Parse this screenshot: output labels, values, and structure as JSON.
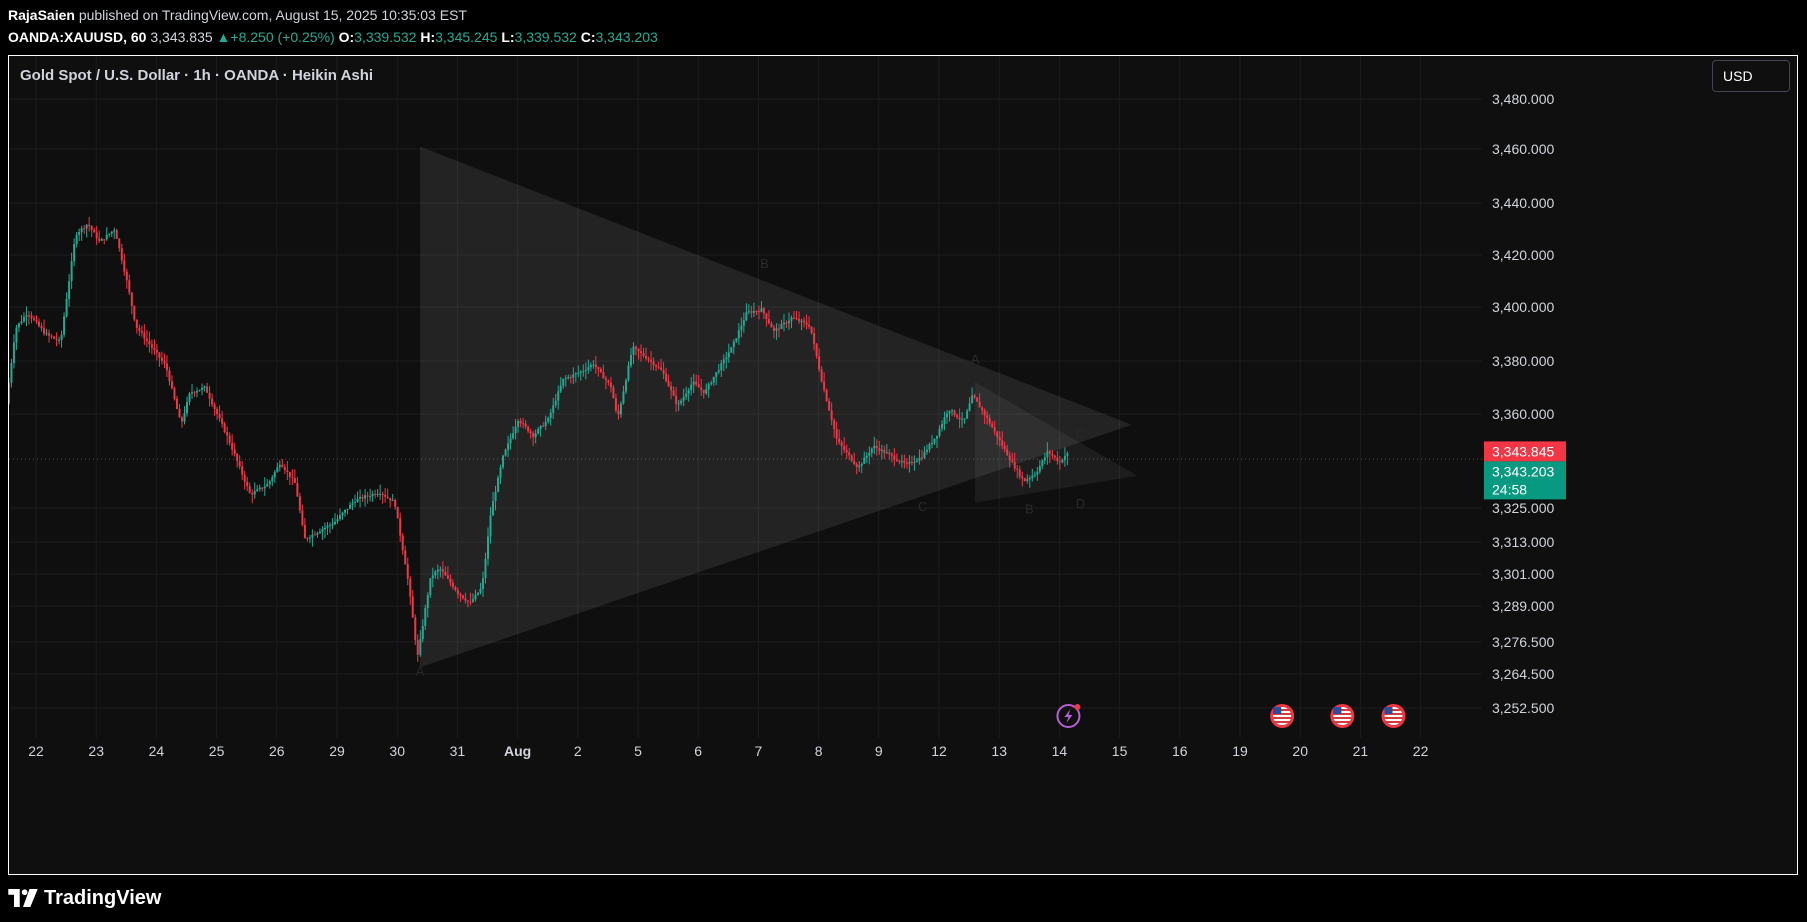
{
  "header": {
    "author": "RajaSaien",
    "published_text": "published on TradingView.com, August 15, 2025 10:35:03 EST",
    "symbol": "OANDA:XAUUSD, 60",
    "last": "3,343.835",
    "arrow": "▲",
    "change": "+8.250 (+0.25%)",
    "o_label": "O:",
    "o_value": "3,339.532",
    "h_label": "H:",
    "h_value": "3,345.245",
    "l_label": "L:",
    "l_value": "3,339.532",
    "c_label": "C:",
    "c_value": "3,343.203"
  },
  "chart": {
    "title": "Gold Spot / U.S. Dollar · 1h · OANDA · Heikin Ashi",
    "currency": "USD"
  },
  "footer": {
    "brand": "TradingView"
  },
  "chart_data": {
    "type": "candlestick",
    "title": "Gold Spot / U.S. Dollar · 1h · OANDA · Heikin Ashi",
    "grid": true,
    "y_axis_side": "right",
    "y_ticks": [
      {
        "v": 3480,
        "label": "3,480.000"
      },
      {
        "v": 3460,
        "label": "3,460.000"
      },
      {
        "v": 3440,
        "label": "3,440.000"
      },
      {
        "v": 3420,
        "label": "3,420.000"
      },
      {
        "v": 3400,
        "label": "3,400.000"
      },
      {
        "v": 3380,
        "label": "3,380.000"
      },
      {
        "v": 3360,
        "label": "3,360.000"
      },
      {
        "v": 3325,
        "label": "3,325.000"
      },
      {
        "v": 3313,
        "label": "3,313.000"
      },
      {
        "v": 3301,
        "label": "3,301.000"
      },
      {
        "v": 3289,
        "label": "3,289.000"
      },
      {
        "v": 3276.5,
        "label": "3,276.500"
      },
      {
        "v": 3264.5,
        "label": "3,264.500"
      },
      {
        "v": 3252.5,
        "label": "3,252.500"
      }
    ],
    "x_ticks": [
      {
        "i": 0,
        "label": "22"
      },
      {
        "i": 1,
        "label": "23"
      },
      {
        "i": 2,
        "label": "24"
      },
      {
        "i": 3,
        "label": "25"
      },
      {
        "i": 4,
        "label": "26"
      },
      {
        "i": 5,
        "label": "29"
      },
      {
        "i": 6,
        "label": "30"
      },
      {
        "i": 7,
        "label": "31"
      },
      {
        "i": 8,
        "label": "Aug",
        "bold": true
      },
      {
        "i": 9,
        "label": "2"
      },
      {
        "i": 10,
        "label": "5"
      },
      {
        "i": 11,
        "label": "6"
      },
      {
        "i": 12,
        "label": "7"
      },
      {
        "i": 13,
        "label": "8"
      },
      {
        "i": 14,
        "label": "9"
      },
      {
        "i": 15,
        "label": "12"
      },
      {
        "i": 16,
        "label": "13"
      },
      {
        "i": 17,
        "label": "14"
      },
      {
        "i": 18,
        "label": "15"
      },
      {
        "i": 19,
        "label": "16"
      },
      {
        "i": 20,
        "label": "19"
      },
      {
        "i": 21,
        "label": "20"
      },
      {
        "i": 22,
        "label": "21"
      },
      {
        "i": 23,
        "label": "22"
      }
    ],
    "price_path": [
      [
        -0.45,
        3364
      ],
      [
        -0.3,
        3392
      ],
      [
        -0.1,
        3398
      ],
      [
        0.2,
        3390
      ],
      [
        0.45,
        3387
      ],
      [
        0.7,
        3428
      ],
      [
        0.9,
        3432
      ],
      [
        1.1,
        3425
      ],
      [
        1.35,
        3430
      ],
      [
        1.55,
        3410
      ],
      [
        1.7,
        3393
      ],
      [
        2.2,
        3378
      ],
      [
        2.45,
        3356
      ],
      [
        2.6,
        3368
      ],
      [
        2.85,
        3370
      ],
      [
        3.25,
        3350
      ],
      [
        3.6,
        3330
      ],
      [
        3.9,
        3334
      ],
      [
        4.1,
        3342
      ],
      [
        4.35,
        3334
      ],
      [
        4.5,
        3314
      ],
      [
        4.75,
        3317
      ],
      [
        5.0,
        3320
      ],
      [
        5.35,
        3328
      ],
      [
        5.75,
        3331
      ],
      [
        6.0,
        3327
      ],
      [
        6.2,
        3302
      ],
      [
        6.38,
        3271
      ],
      [
        6.6,
        3300
      ],
      [
        6.75,
        3303
      ],
      [
        7.05,
        3294
      ],
      [
        7.25,
        3290
      ],
      [
        7.45,
        3296
      ],
      [
        7.6,
        3324
      ],
      [
        7.8,
        3344
      ],
      [
        8.05,
        3358
      ],
      [
        8.3,
        3352
      ],
      [
        8.55,
        3358
      ],
      [
        8.8,
        3373
      ],
      [
        9.1,
        3376
      ],
      [
        9.3,
        3379
      ],
      [
        9.6,
        3370
      ],
      [
        9.7,
        3358
      ],
      [
        9.95,
        3385
      ],
      [
        10.2,
        3381
      ],
      [
        10.45,
        3376
      ],
      [
        10.7,
        3363
      ],
      [
        10.95,
        3372
      ],
      [
        11.15,
        3368
      ],
      [
        11.3,
        3374
      ],
      [
        11.6,
        3385
      ],
      [
        11.85,
        3398
      ],
      [
        12.1,
        3399
      ],
      [
        12.3,
        3391
      ],
      [
        12.6,
        3396
      ],
      [
        12.9,
        3393
      ],
      [
        13.1,
        3372
      ],
      [
        13.35,
        3350
      ],
      [
        13.7,
        3340
      ],
      [
        13.95,
        3348
      ],
      [
        14.2,
        3345
      ],
      [
        14.5,
        3341
      ],
      [
        14.75,
        3344
      ],
      [
        15.0,
        3352
      ],
      [
        15.2,
        3362
      ],
      [
        15.45,
        3357
      ],
      [
        15.6,
        3367
      ],
      [
        15.85,
        3358
      ],
      [
        16.05,
        3350
      ],
      [
        16.25,
        3342
      ],
      [
        16.45,
        3335
      ],
      [
        16.65,
        3338
      ],
      [
        16.85,
        3346
      ],
      [
        17.05,
        3342
      ],
      [
        17.15,
        3345
      ]
    ],
    "volatility_note_none": "",
    "pattern_outer": [
      [
        6.38,
        3461
      ],
      [
        6.38,
        3267
      ],
      [
        18.2,
        3356
      ]
    ],
    "pattern_inner": [
      [
        15.6,
        3372
      ],
      [
        15.6,
        3327
      ],
      [
        18.3,
        3337
      ]
    ],
    "wave_labels": [
      {
        "x": 6.38,
        "y": 3264,
        "text": "A"
      },
      {
        "x": 12.1,
        "y": 3415,
        "text": "B"
      },
      {
        "x": 14.73,
        "y": 3324,
        "text": "C"
      },
      {
        "x": 15.6,
        "y": 3379,
        "text": "A"
      },
      {
        "x": 16.5,
        "y": 3323,
        "text": "B"
      },
      {
        "x": 17.35,
        "y": 3351,
        "text": "C"
      },
      {
        "x": 17.35,
        "y": 3325,
        "text": "D"
      }
    ],
    "current_price": 3343.203,
    "price_tags": [
      {
        "v": 3343.845,
        "label": "3,343.845",
        "color": "#f23645"
      },
      {
        "v": 3343.203,
        "label": "3,343.203",
        "sub": "24:58",
        "color": "#089981"
      }
    ],
    "events": [
      {
        "x": 17.15,
        "kind": "bolt"
      },
      {
        "x": 20.7,
        "kind": "us-flag"
      },
      {
        "x": 21.7,
        "kind": "us-flag"
      },
      {
        "x": 22.55,
        "kind": "us-flag"
      }
    ],
    "colors": {
      "up": "#22ab94",
      "down": "#f23645",
      "grid": "#1c1c1c",
      "pattern": "#ffffff"
    }
  }
}
